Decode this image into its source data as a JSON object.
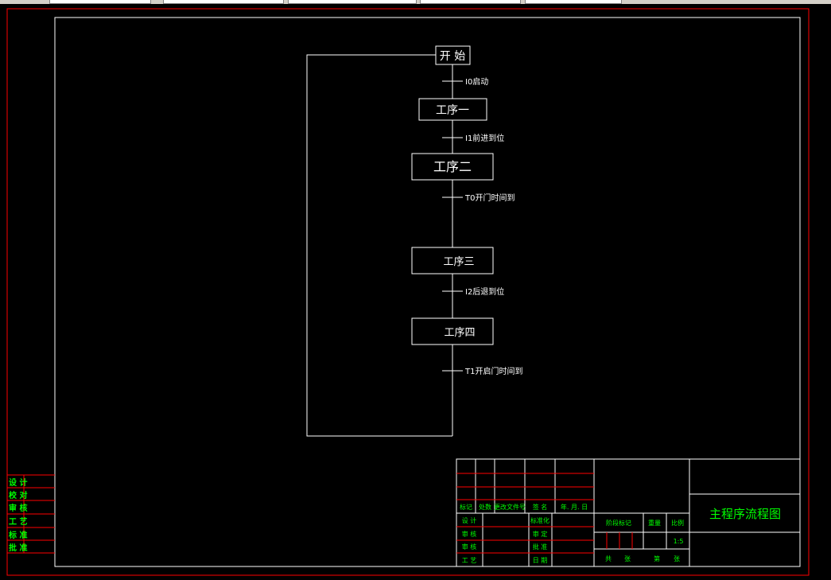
{
  "flowchart": {
    "start": "开 始",
    "steps": [
      "工序一",
      "工序二",
      "工序三",
      "工序四"
    ],
    "transitions": [
      "I0启动",
      "I1前进到位",
      "T0开门时间到",
      "I2后退到位",
      "T1开启门时间到"
    ]
  },
  "title_block": {
    "drawing_title": "主程序流程图",
    "revision_headers": [
      "标记",
      "处数",
      "更改文件号",
      "签 名",
      "年. 月. 日"
    ],
    "left_roles": [
      "设 计",
      "审 核",
      "审 核",
      "工 艺"
    ],
    "middle_roles": [
      "标准化",
      "审 定",
      "批 准",
      "日 期"
    ],
    "stage_headers": [
      "阶段标记",
      "重量",
      "比例"
    ],
    "scale": "1:5",
    "sheet_labels": [
      "共",
      "张",
      "第",
      "张"
    ]
  },
  "side_stamp": {
    "labels": [
      "设 计",
      "校 对",
      "审 核",
      "工 艺",
      "标 准",
      "批 准"
    ]
  },
  "colors": {
    "background": "#000000",
    "lines": "#ffffff",
    "border": "#ff0000",
    "text_label": "#00ff00",
    "text_flow": "#ffffff",
    "toolbar": "#d4d0c8"
  }
}
